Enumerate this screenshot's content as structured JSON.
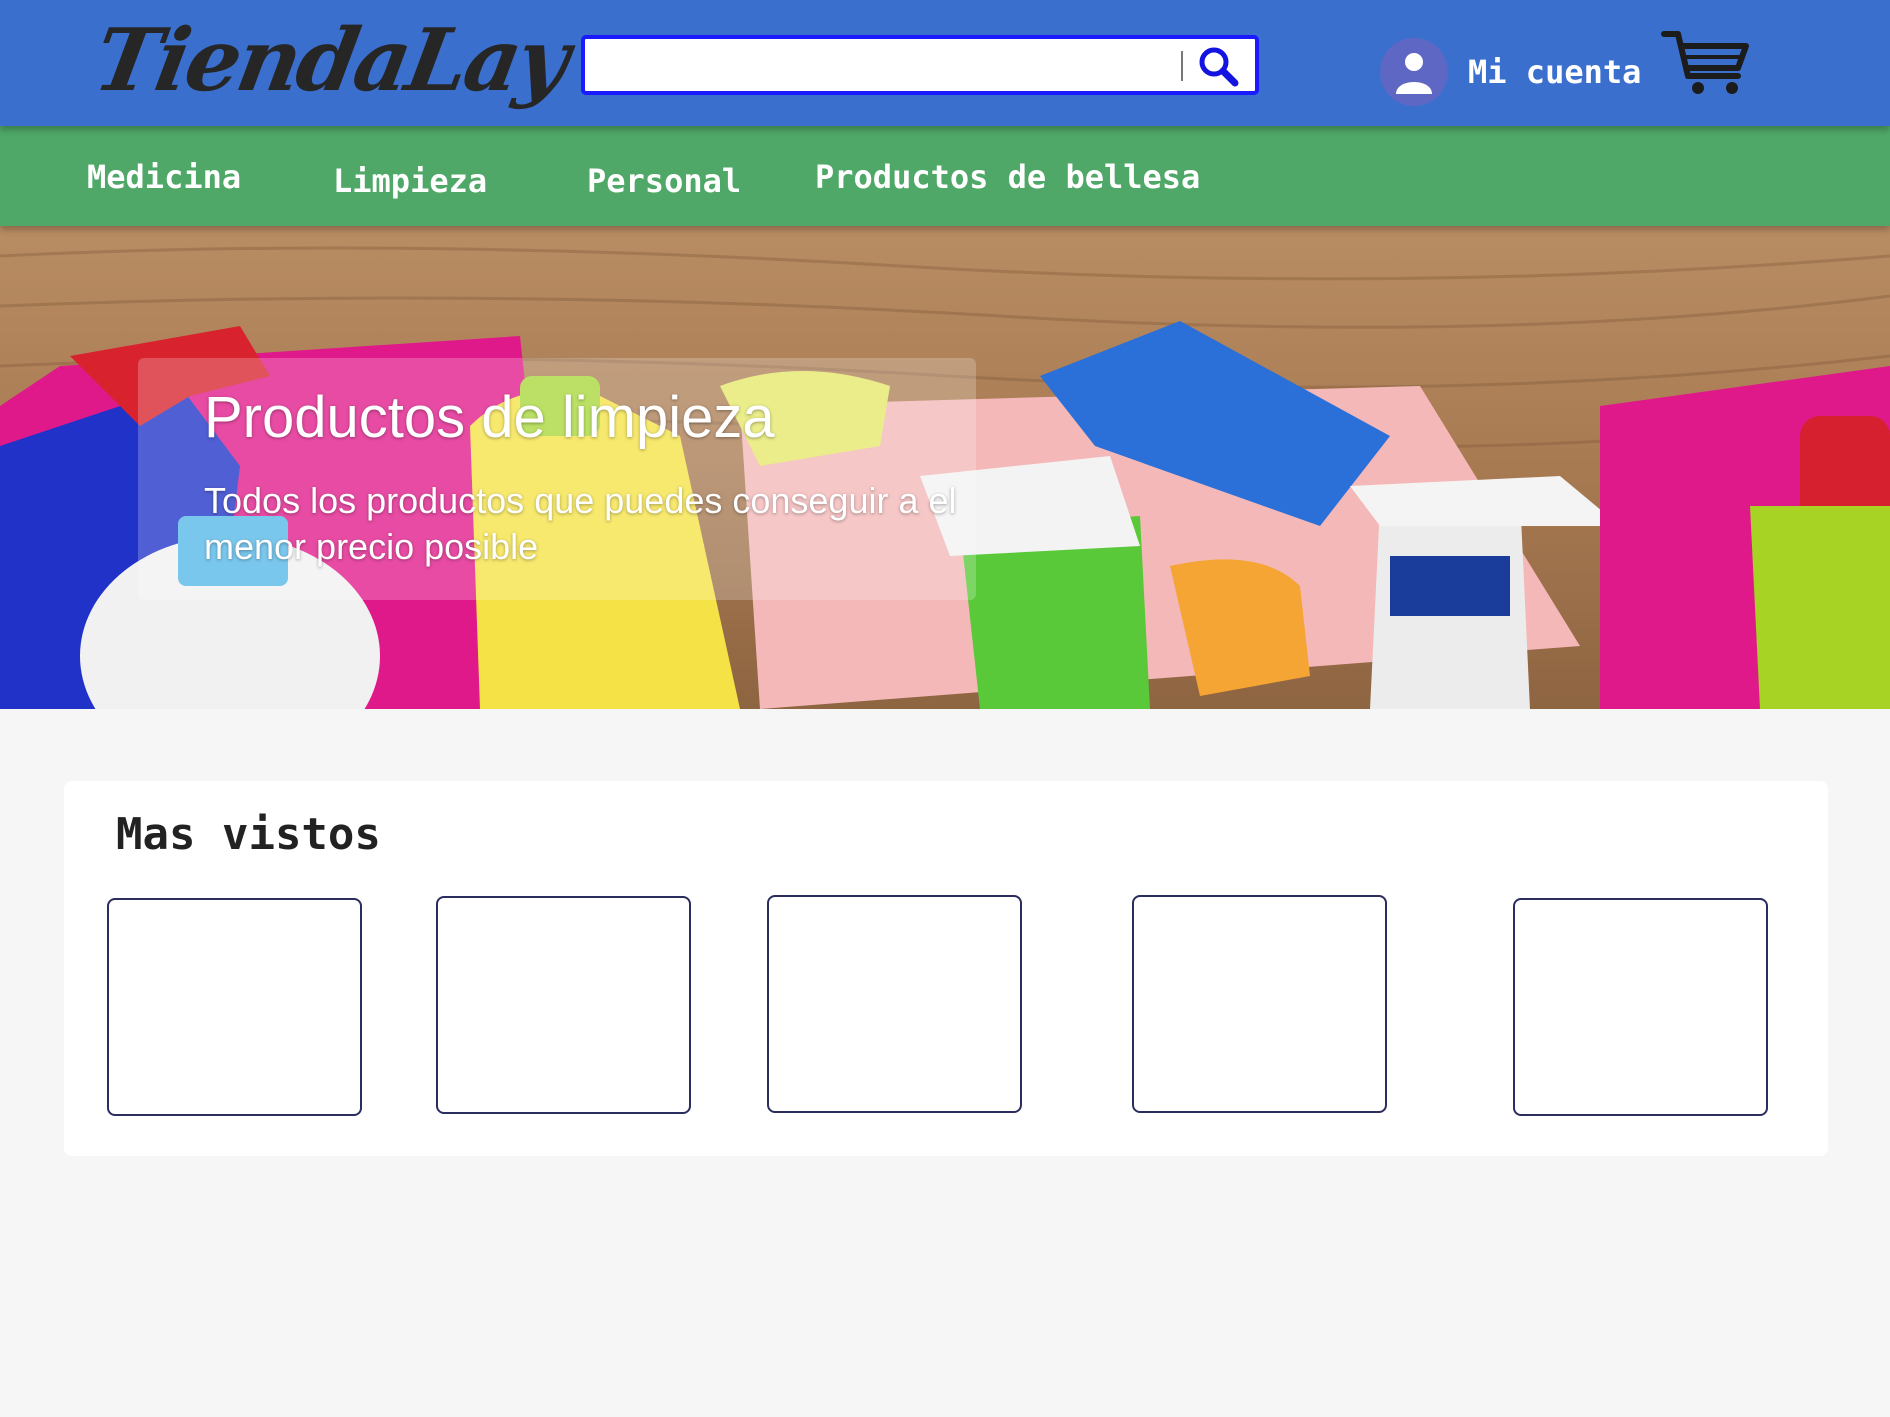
{
  "header": {
    "logo_text": "TiendaLay",
    "search": {
      "value": "",
      "placeholder": ""
    },
    "search_icon": "search-icon",
    "account": {
      "label": "Mi cuenta",
      "icon": "user-avatar-icon"
    },
    "cart_icon": "shopping-cart-icon"
  },
  "nav": {
    "items": [
      {
        "label": "Medicina"
      },
      {
        "label": "Limpieza"
      },
      {
        "label": "Personal"
      },
      {
        "label": "Productos de bellesa"
      }
    ]
  },
  "hero": {
    "title": "Productos de limpieza",
    "subtitle": "Todos los productos que puedes conseguir a el menor precio posible"
  },
  "most_viewed": {
    "title": "Mas vistos",
    "products": [
      {
        "label": ""
      },
      {
        "label": ""
      },
      {
        "label": ""
      },
      {
        "label": ""
      },
      {
        "label": ""
      }
    ]
  },
  "colors": {
    "header_bg": "#3a6fce",
    "nav_bg": "#4fa868",
    "search_border": "#1a1aff",
    "card_border": "#2b2d5e",
    "page_bg": "#f6f6f6"
  }
}
